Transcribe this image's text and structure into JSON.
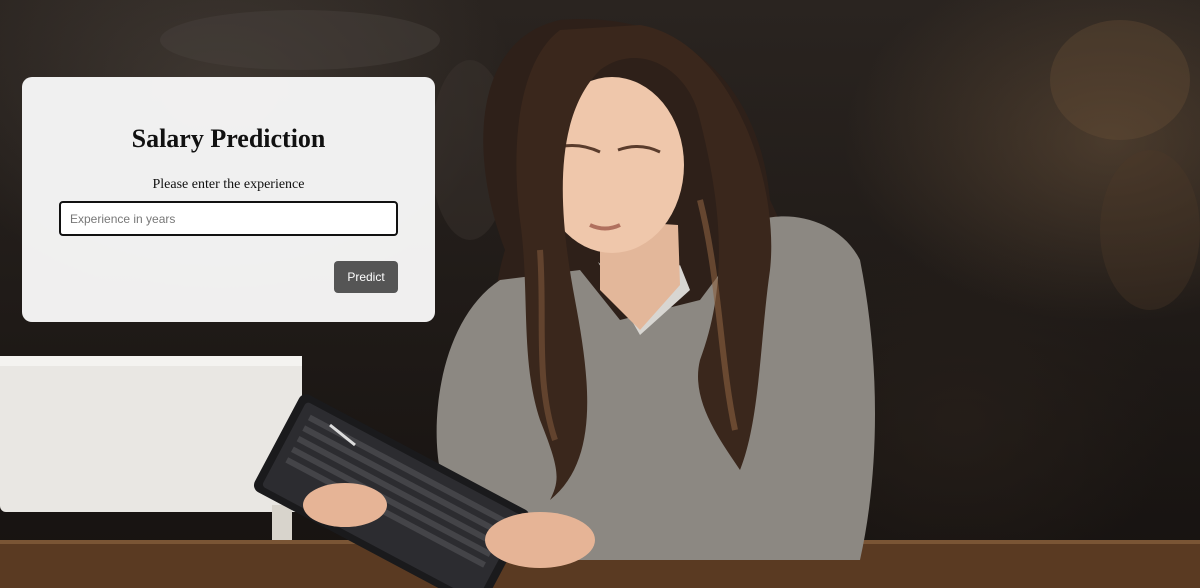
{
  "form": {
    "title": "Salary Prediction",
    "label": "Please enter the experience",
    "input": {
      "value": "",
      "placeholder": "Experience in years"
    },
    "button_label": "Predict"
  },
  "background": {
    "icon": "photo-woman-with-tablet"
  },
  "colors": {
    "card": "#f7f7f7",
    "button": "#555555",
    "button_text": "#ffffff"
  }
}
